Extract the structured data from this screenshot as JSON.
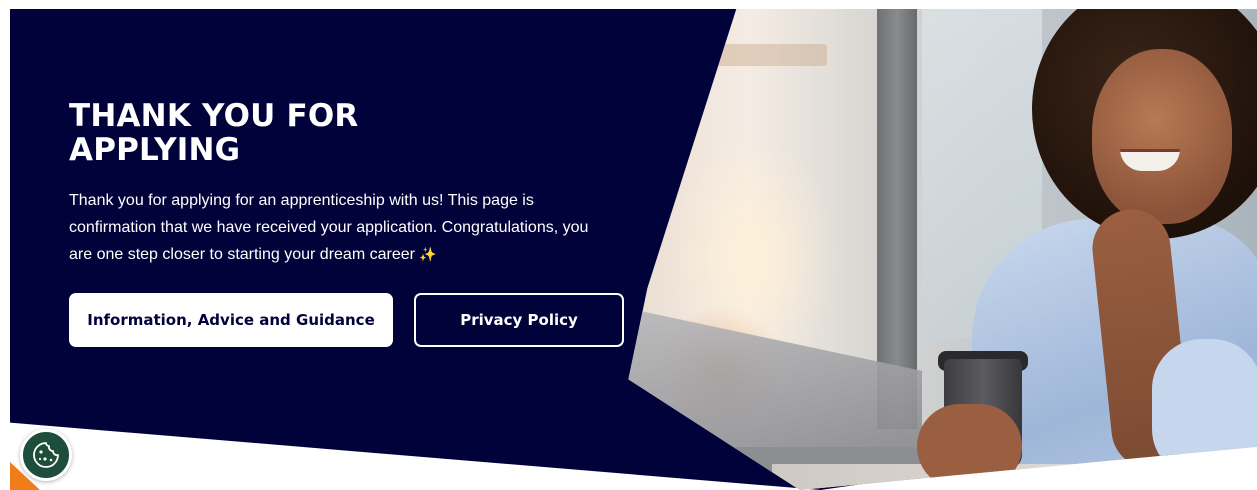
{
  "hero": {
    "title": "THANK YOU FOR APPLYING",
    "body": "Thank you for applying for an apprenticeship with us! This page is confirmation that we have received your application. Congratulations, you are one step closer to starting your dream career",
    "sparkle": "✨"
  },
  "buttons": {
    "primary_label": "Information, Advice and Guidance",
    "secondary_label": "Privacy Policy"
  },
  "cookie": {
    "icon": "cookie-icon"
  },
  "colors": {
    "hero_background": "#02023a",
    "primary_button_background": "#ffffff",
    "cookie_button_background": "#1e4d3b",
    "accent_orange": "#ef7d1a"
  }
}
